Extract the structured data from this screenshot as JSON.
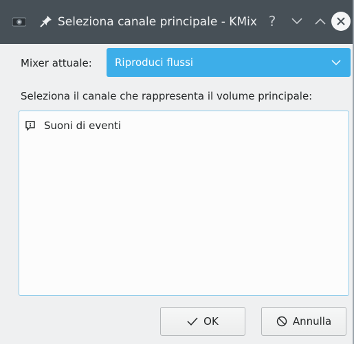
{
  "window": {
    "title": "Seleziona canale principale - KMix",
    "help_glyph": "?"
  },
  "mixer": {
    "label": "Mixer attuale:",
    "selected": "Riproduci flussi"
  },
  "channels": {
    "label": "Seleziona il canale che rappresenta il volume principale:",
    "items": [
      {
        "label": "Suoni di eventi",
        "icon": "notification-icon"
      }
    ]
  },
  "buttons": {
    "ok_label": "OK",
    "cancel_label": "Annulla"
  },
  "colors": {
    "titlebar": "#475057",
    "accent": "#3daee9",
    "background": "#eff0f1"
  }
}
